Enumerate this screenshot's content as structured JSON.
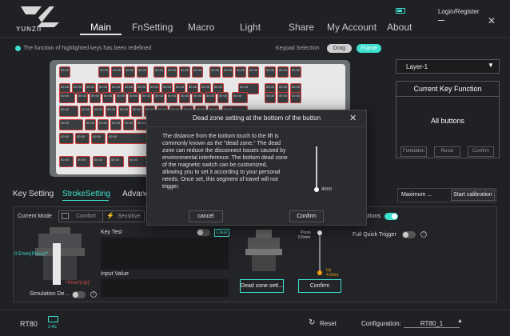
{
  "brand": {
    "name": "YUNZII"
  },
  "nav": {
    "tabs": [
      "Main",
      "FnSetting",
      "Macro",
      "Light",
      "Share",
      "My Account",
      "About"
    ],
    "active": "Main"
  },
  "header": {
    "login_label": "Login/Register"
  },
  "notice": "The function of highlighted keys has been redefined",
  "keypad": {
    "label": "Keypad Selection",
    "drag": "Drag",
    "frame": "Frame"
  },
  "layer": {
    "selected": "Layer-1",
    "arrow": "▼"
  },
  "key_function": {
    "title": "Current Key Function",
    "value": "All buttons",
    "forbidden": "Forbidden",
    "reset": "Reset",
    "confirm": "Confirm"
  },
  "subtabs": {
    "key_setting": "Key Setting",
    "stroke_setting": "StrokeSetting",
    "advanced": "Advanc"
  },
  "maximum": {
    "label": "Maximum ...",
    "calibration": "Start calibration"
  },
  "stroke": {
    "current_mode": "Current Mode",
    "comfort": "Comfort",
    "sensitive": "Sensitive",
    "press_label": "0.5'mm(Press)'*",
    "up_label": "*4'mm'(Up)'",
    "simulation": "Simulation De...",
    "key_test": "Key Test",
    "clear": "Clear",
    "input_value": "Input Value",
    "buttons_label": "uttons",
    "full_quick_trigger": "Full Quick Trigger",
    "press_marker": "Press",
    "press_value": "0.5mm",
    "up_marker": "Up",
    "up_value": "4.0mm",
    "dead_zone_btn": "Dead zone sett...",
    "confirm": "Confirm"
  },
  "modal": {
    "title": "Dead zone setting at the bottom of the button",
    "close": "✕",
    "body": "The distance from the bottom touch to the lift is commonly known as the \"dead zone.\" The dead zone can reduce the disconnect issues caused by environmental interference. The bottom dead zone of the magnetic switch can be customized, allowing you to set it according to your personal needs. Once set, this segment of travel will not trigger.",
    "slider_value": "4mm",
    "cancel": "cancel",
    "confirm": "Confirm"
  },
  "footer": {
    "model": "RT80",
    "wireless": "2.4G",
    "reset": "Reset",
    "config_label": "Configuration:",
    "config_value": "RT80_1"
  },
  "key_label": "00 00",
  "colors": {
    "accent": "#3fe0d0",
    "key_border": "#d23a3a"
  }
}
